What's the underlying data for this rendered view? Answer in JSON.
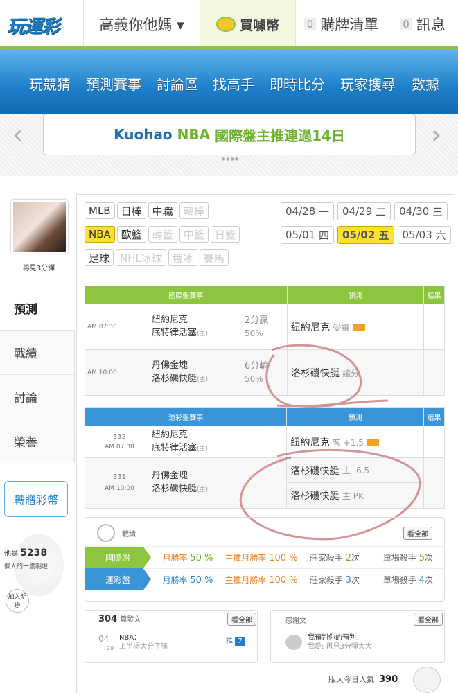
{
  "header": {
    "logo": "玩運彩",
    "user": "高義你他媽 ▾",
    "buy": "買噱幣",
    "cart_count": "0",
    "cart": "購牌清單",
    "msg_count": "0",
    "msg": "訊息"
  },
  "nav": [
    "玩競猜",
    "預測賽事",
    "討論區",
    "找高手",
    "即時比分",
    "玩家搜尋",
    "數據"
  ],
  "banner": {
    "author": "Kuohao",
    "sport": "NBA",
    "text": "國際盤主推連過14日",
    "prev": "‹",
    "next": "›",
    "dots": "●●●●"
  },
  "sidebar": {
    "caption": "再見3分彈",
    "tabs": [
      "預測",
      "戰績",
      "討論",
      "榮譽"
    ],
    "donate": "轉贈彩幣",
    "light_label": "他是",
    "light_count": "5238",
    "light_text": "個人的一盞明燈",
    "join": "加入明燈"
  },
  "sports": {
    "row1": [
      "MLB",
      "日棒",
      "中職",
      "韓棒"
    ],
    "row2": [
      "NBA",
      "歐籃",
      "韓籃",
      "中籃",
      "日籃"
    ],
    "row3": [
      "足球",
      "NHL冰球",
      "俄冰",
      "賽馬"
    ]
  },
  "dates": [
    {
      "d": "04/28",
      "w": "一"
    },
    {
      "d": "04/29",
      "w": "二"
    },
    {
      "d": "04/30",
      "w": "三"
    },
    {
      "d": "05/01",
      "w": "四"
    },
    {
      "d": "05/02",
      "w": "五"
    },
    {
      "d": "05/03",
      "w": "六"
    }
  ],
  "intl": {
    "h1": "國際盤賽事",
    "h2": "預測",
    "h3": "結果",
    "games": [
      {
        "time": "AM 07:30",
        "away": "紐約尼克",
        "home": "底特律活塞",
        "home_tag": "(主)",
        "line": "2分贏",
        "pct": "50%",
        "pick": "紐約尼克",
        "pick_note": "受讓"
      },
      {
        "time": "AM 10:00",
        "away": "丹佛金塊",
        "home": "洛杉磯快艇",
        "home_tag": "(主)",
        "line": "6分輸",
        "pct": "50%",
        "pick": "洛杉磯快艇",
        "pick_note": "讓分"
      }
    ]
  },
  "sport_lottery": {
    "h1": "運彩盤賽事",
    "h2": "預測",
    "h3": "結果",
    "games": [
      {
        "no": "332",
        "time": "AM 07:30",
        "away": "紐約尼克",
        "home": "底特律活塞",
        "home_tag": "(主)",
        "pick": "紐約尼克",
        "pick_note": "客 +1.5"
      },
      {
        "no": "331",
        "time": "AM 10:00",
        "away": "丹佛金塊",
        "home": "洛杉磯快艇",
        "home_tag": "(主)",
        "pick": "洛杉磯快艇",
        "pick_note": "主 -6.5",
        "pick2": "洛杉磯快艇",
        "pick2_note": "主 PK"
      }
    ]
  },
  "record": {
    "title": "戰績",
    "view_all": "看全部",
    "rows": [
      {
        "name": "國際盤",
        "m1": "月勝率",
        "v1": "50 %",
        "m2": "主推月勝率",
        "v2": "100 %",
        "m3": "莊家殺手",
        "v3": "2",
        "u3": "次",
        "m4": "單場殺手",
        "v4": "5",
        "u4": "次"
      },
      {
        "name": "運彩盤",
        "m1": "月勝率",
        "v1": "50 %",
        "m2": "主推月勝率",
        "v2": "100 %",
        "m3": "莊家殺手",
        "v3": "3",
        "u3": "次",
        "m4": "單場殺手",
        "v4": "4",
        "u4": "次"
      }
    ]
  },
  "posts": {
    "count": "304",
    "label": "篇發文",
    "view_all": "看全部",
    "date_m": "04",
    "date_d": "29",
    "title": "NBA：",
    "body": "上半場大分了嗎",
    "push": "推",
    "push_count": "7"
  },
  "thanks": {
    "label": "感謝文",
    "view_all": "看全部",
    "title": "我預判你的預判：",
    "body": "我愛: 再見3分彈大大"
  },
  "footer": {
    "label": "版大今日人氣",
    "count": "390"
  },
  "colors": {
    "green": "#8cc63f",
    "blue": "#3a94d8",
    "nav": "#1d7fc9",
    "highlight": "#ffe033"
  }
}
